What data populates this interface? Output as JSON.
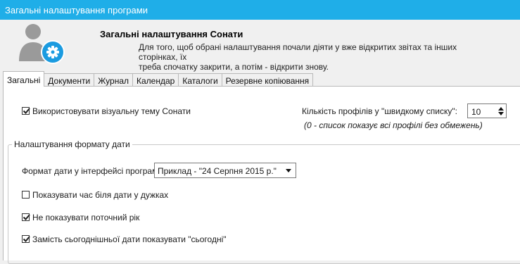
{
  "window": {
    "title": "Загальні налаштування програми"
  },
  "header": {
    "title": "Загальні налаштування Сонати",
    "description_line1": "Для того, щоб обрані налаштування почали діяти у вже відкритих звітах та інших сторінках, їх",
    "description_line2": "треба спочатку закрити, а потім - відкрити знову."
  },
  "tabs": [
    {
      "label": "Загальні",
      "active": true
    },
    {
      "label": "Документи",
      "active": false
    },
    {
      "label": "Журнал",
      "active": false
    },
    {
      "label": "Календар",
      "active": false
    },
    {
      "label": "Каталоги",
      "active": false
    },
    {
      "label": "Резервне копіювання",
      "active": false
    }
  ],
  "general": {
    "visual_theme": {
      "label": "Використовувати візуальну тему Сонати",
      "checked": true
    },
    "profiles": {
      "label": "Кількість профілів у \"швидкому списку\":",
      "value": "10",
      "hint": "(0 - список показує всі профілі без обмежень)"
    }
  },
  "date_format": {
    "group_title": "Налаштування формату дати",
    "format_label": "Формат дати у інтерфейсі програми:",
    "format_value": "Приклад - \"24 Серпня 2015 р.\"",
    "show_time": {
      "label": "Показувати час біля дати у дужках",
      "checked": false
    },
    "hide_current_year": {
      "label": "Не показувати поточний рік",
      "checked": true
    },
    "show_today": {
      "label": "Замість сьогоднішньої дати показувати \"сьогодні\"",
      "checked": true
    }
  },
  "colors": {
    "titlebar": "#1faee8",
    "accent_icon": "#1b9be0",
    "avatar": "#9a9a9a"
  },
  "icons": {
    "avatar": "user-settings-icon",
    "check": "checkmark-icon"
  }
}
